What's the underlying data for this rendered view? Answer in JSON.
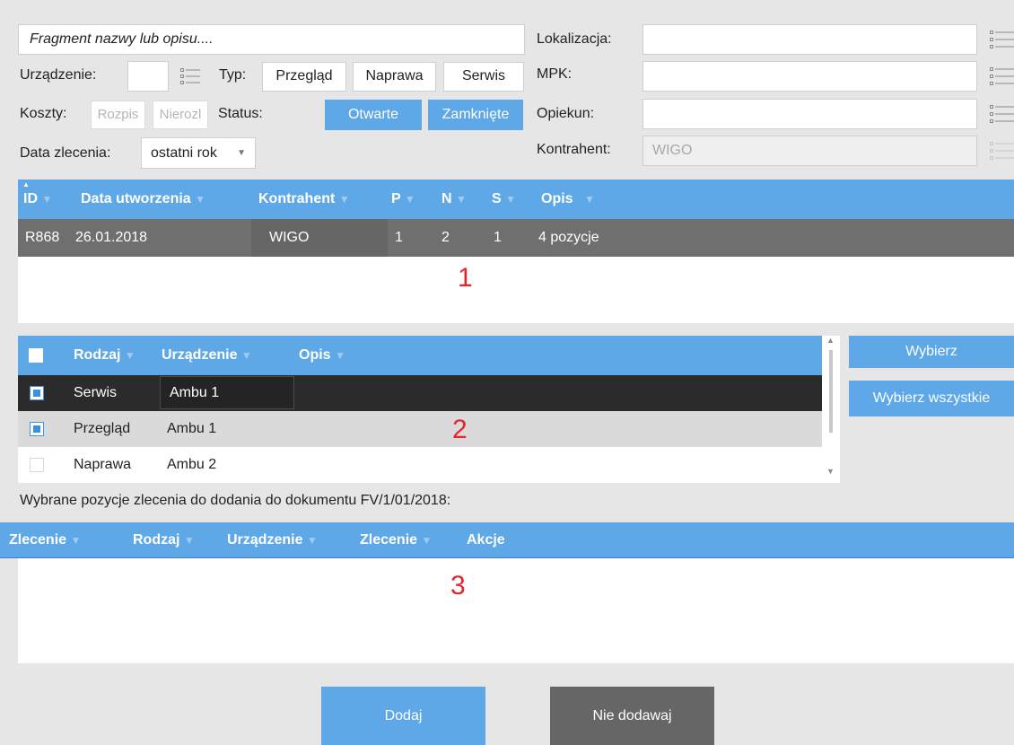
{
  "filters": {
    "search_placeholder": "Fragment nazwy lub opisu....",
    "device_label": "Urządzenie:",
    "type_label": "Typ:",
    "type_options": [
      "Przegląd",
      "Naprawa",
      "Serwis"
    ],
    "costs_label": "Koszty:",
    "costs_options": [
      "Rozpis",
      "Nierozl"
    ],
    "status_label": "Status:",
    "status_options": [
      "Otwarte",
      "Zamknięte"
    ],
    "date_label": "Data zlecenia:",
    "date_value": "ostatni rok",
    "location_label": "Lokalizacja:",
    "mpk_label": "MPK:",
    "guardian_label": "Opiekun:",
    "contractor_label": "Kontrahent:",
    "contractor_value": "WIGO"
  },
  "orders_grid": {
    "columns": [
      "ID",
      "Data utworzenia",
      "Kontrahent",
      "P",
      "N",
      "S",
      "Opis"
    ],
    "rows": [
      {
        "id": "R868",
        "date": "26.01.2018",
        "contractor": "WIGO",
        "p": "1",
        "n": "2",
        "s": "1",
        "desc": "4 pozycje"
      }
    ],
    "marker": "1"
  },
  "items_grid": {
    "columns": [
      "Rodzaj",
      "Urządzenie",
      "Opis"
    ],
    "rows": [
      {
        "kind": "Serwis",
        "device": "Ambu 1",
        "checked": true
      },
      {
        "kind": "Przegląd",
        "device": "Ambu 1",
        "checked": true
      },
      {
        "kind": "Naprawa",
        "device": "Ambu 2",
        "checked": false
      }
    ],
    "marker": "2"
  },
  "side_buttons": {
    "select": "Wybierz",
    "select_all": "Wybierz wszystkie"
  },
  "selected_caption": "Wybrane pozycje zlecenia do dodania do dokumentu FV/1/01/2018:",
  "selected_grid": {
    "columns": [
      "Zlecenie",
      "Rodzaj",
      "Urządzenie",
      "Zlecenie",
      "Akcje"
    ],
    "marker": "3"
  },
  "footer": {
    "add": "Dodaj",
    "dont_add": "Nie dodawaj"
  },
  "colors": {
    "accent": "#5ea8e8",
    "dark_row": "#6f6f6f",
    "selected_row": "#2b2b2b",
    "marker": "#e8232a"
  }
}
